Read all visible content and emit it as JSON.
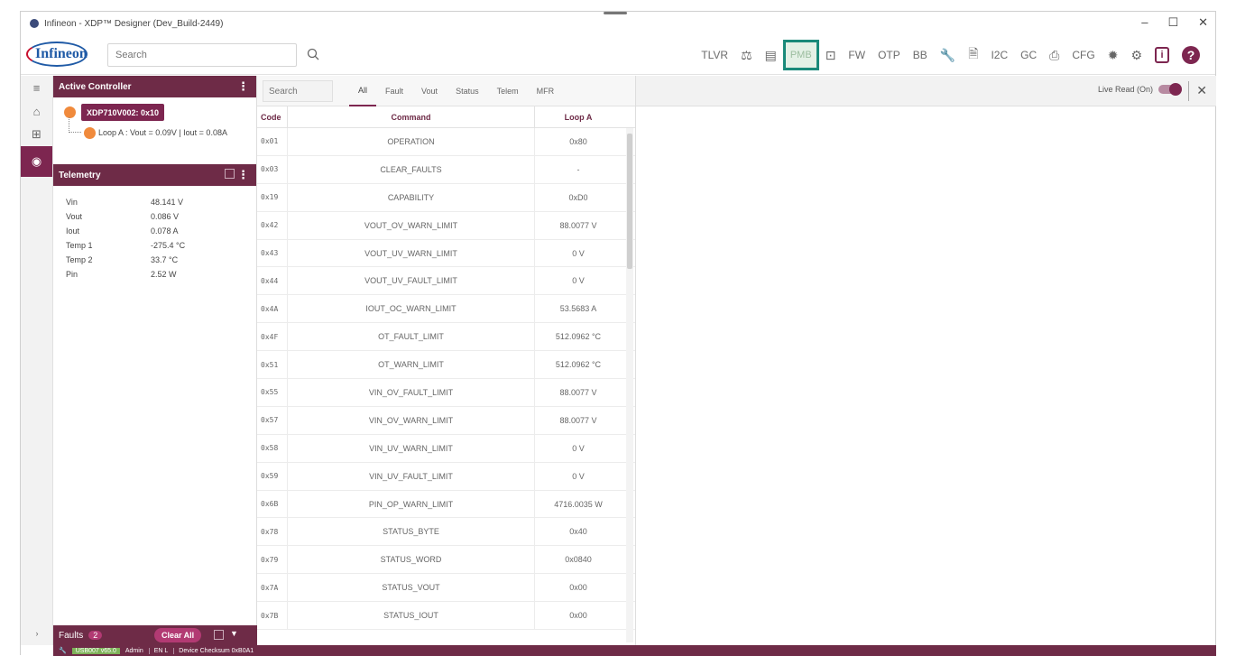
{
  "window": {
    "title": "Infineon - XDP™ Designer (Dev_Build-2449)",
    "minimize": "–",
    "maximize": "☐",
    "close": "✕"
  },
  "toolbar": {
    "logo_text": "Infineon",
    "search_placeholder": "Search",
    "tools": [
      "TLVR",
      "FW",
      "OTP",
      "BB",
      "I2C",
      "GC",
      "CFG"
    ],
    "pmb_label": "PMB",
    "help_label": "?",
    "info_label": "i"
  },
  "active_controller": {
    "header": "Active Controller",
    "controller_name": "XDP710V002: 0x10",
    "loop_text": "Loop A : Vout = 0.09V | Iout = 0.08A"
  },
  "telemetry": {
    "header": "Telemetry",
    "rows": [
      {
        "label": "Vin",
        "value": "48.141 V"
      },
      {
        "label": "Vout",
        "value": "0.086 V"
      },
      {
        "label": "Iout",
        "value": "0.078 A"
      },
      {
        "label": "Temp 1",
        "value": "-275.4 °C"
      },
      {
        "label": "Temp 2",
        "value": "33.7 °C"
      },
      {
        "label": "Pin",
        "value": "2.52 W"
      }
    ]
  },
  "faults": {
    "label": "Faults",
    "count": "2",
    "clear_label": "Clear All"
  },
  "commands": {
    "search_placeholder": "Search",
    "tabs": [
      "All",
      "Fault",
      "Vout",
      "Status",
      "Telem",
      "MFR"
    ],
    "columns": [
      "Code",
      "Command",
      "Loop A"
    ],
    "rows": [
      {
        "code": "0x01",
        "command": "OPERATION",
        "value": "0x80"
      },
      {
        "code": "0x03",
        "command": "CLEAR_FAULTS",
        "value": "-"
      },
      {
        "code": "0x19",
        "command": "CAPABILITY",
        "value": "0xD0"
      },
      {
        "code": "0x42",
        "command": "VOUT_OV_WARN_LIMIT",
        "value": "88.0077 V"
      },
      {
        "code": "0x43",
        "command": "VOUT_UV_WARN_LIMIT",
        "value": "0 V"
      },
      {
        "code": "0x44",
        "command": "VOUT_UV_FAULT_LIMIT",
        "value": "0 V"
      },
      {
        "code": "0x4A",
        "command": "IOUT_OC_WARN_LIMIT",
        "value": "53.5683 A"
      },
      {
        "code": "0x4F",
        "command": "OT_FAULT_LIMIT",
        "value": "512.0962 °C"
      },
      {
        "code": "0x51",
        "command": "OT_WARN_LIMIT",
        "value": "512.0962 °C"
      },
      {
        "code": "0x55",
        "command": "VIN_OV_FAULT_LIMIT",
        "value": "88.0077 V"
      },
      {
        "code": "0x57",
        "command": "VIN_OV_WARN_LIMIT",
        "value": "88.0077 V"
      },
      {
        "code": "0x58",
        "command": "VIN_UV_WARN_LIMIT",
        "value": "0 V"
      },
      {
        "code": "0x59",
        "command": "VIN_UV_FAULT_LIMIT",
        "value": "0 V"
      },
      {
        "code": "0x6B",
        "command": "PIN_OP_WARN_LIMIT",
        "value": "4716.0035 W"
      },
      {
        "code": "0x78",
        "command": "STATUS_BYTE",
        "value": "0x40"
      },
      {
        "code": "0x79",
        "command": "STATUS_WORD",
        "value": "0x0840"
      },
      {
        "code": "0x7A",
        "command": "STATUS_VOUT",
        "value": "0x00"
      },
      {
        "code": "0x7B",
        "command": "STATUS_IOUT",
        "value": "0x00"
      }
    ]
  },
  "detail": {
    "live_read_label": "Live Read (On)"
  },
  "statusbar": {
    "usb": "USB007 v65.0",
    "user": "Admin",
    "lang": "EN L",
    "checksum": "Device Checksum 0xB0A1"
  },
  "colors": {
    "brand": "#7d2650",
    "panel_header": "#6e2b47",
    "highlight": "#1a8a7a",
    "status_dot": "#f08a3c"
  }
}
